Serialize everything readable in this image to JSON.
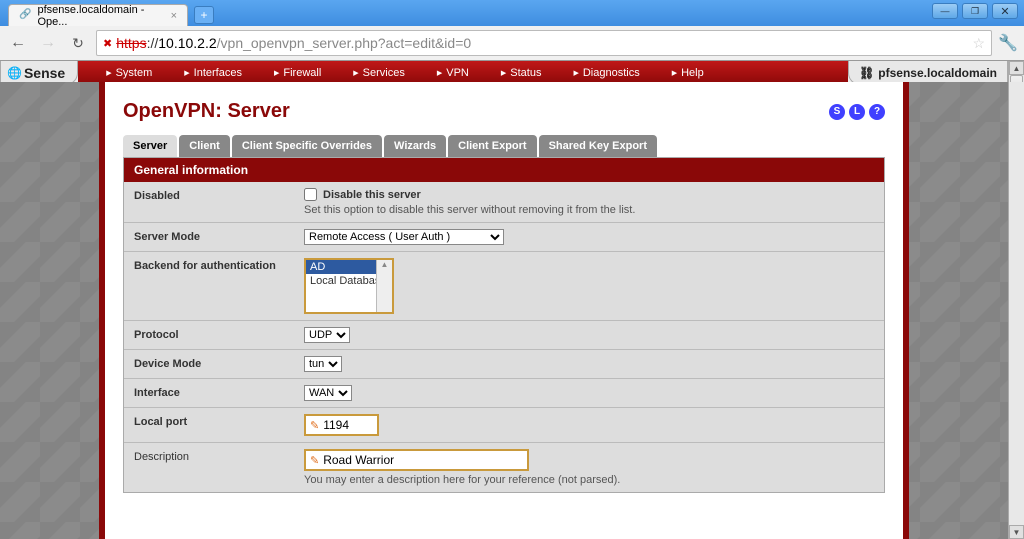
{
  "browser": {
    "tab_title": "pfsense.localdomain - Ope...",
    "url_scheme_struck": "https",
    "url_sep": "://",
    "url_host": "10.10.2.2",
    "url_path": "/vpn_openvpn_server.php?act=edit&id=0"
  },
  "nav": {
    "menus": [
      "System",
      "Interfaces",
      "Firewall",
      "Services",
      "VPN",
      "Status",
      "Diagnostics",
      "Help"
    ],
    "logo_text": "Sense",
    "host_label": "pfsense.localdomain"
  },
  "page": {
    "title": "OpenVPN: Server",
    "help_icons": [
      "S",
      "L",
      "?"
    ],
    "tabs": [
      "Server",
      "Client",
      "Client Specific Overrides",
      "Wizards",
      "Client Export",
      "Shared Key Export"
    ],
    "active_tab_index": 0
  },
  "form": {
    "section_header": "General information",
    "rows": {
      "disabled": {
        "label": "Disabled",
        "checkbox_label": "Disable this server",
        "hint": "Set this option to disable this server without removing it from the list."
      },
      "server_mode": {
        "label": "Server Mode",
        "value": "Remote Access ( User Auth )"
      },
      "backend": {
        "label": "Backend for authentication",
        "options": [
          "AD",
          "Local Database"
        ],
        "selected_index": 0
      },
      "protocol": {
        "label": "Protocol",
        "value": "UDP"
      },
      "device_mode": {
        "label": "Device Mode",
        "value": "tun"
      },
      "interface": {
        "label": "Interface",
        "value": "WAN"
      },
      "local_port": {
        "label": "Local port",
        "value": "1194"
      },
      "description": {
        "label": "Description",
        "value": "Road Warrior",
        "hint": "You may enter a description here for your reference (not parsed)."
      }
    }
  }
}
